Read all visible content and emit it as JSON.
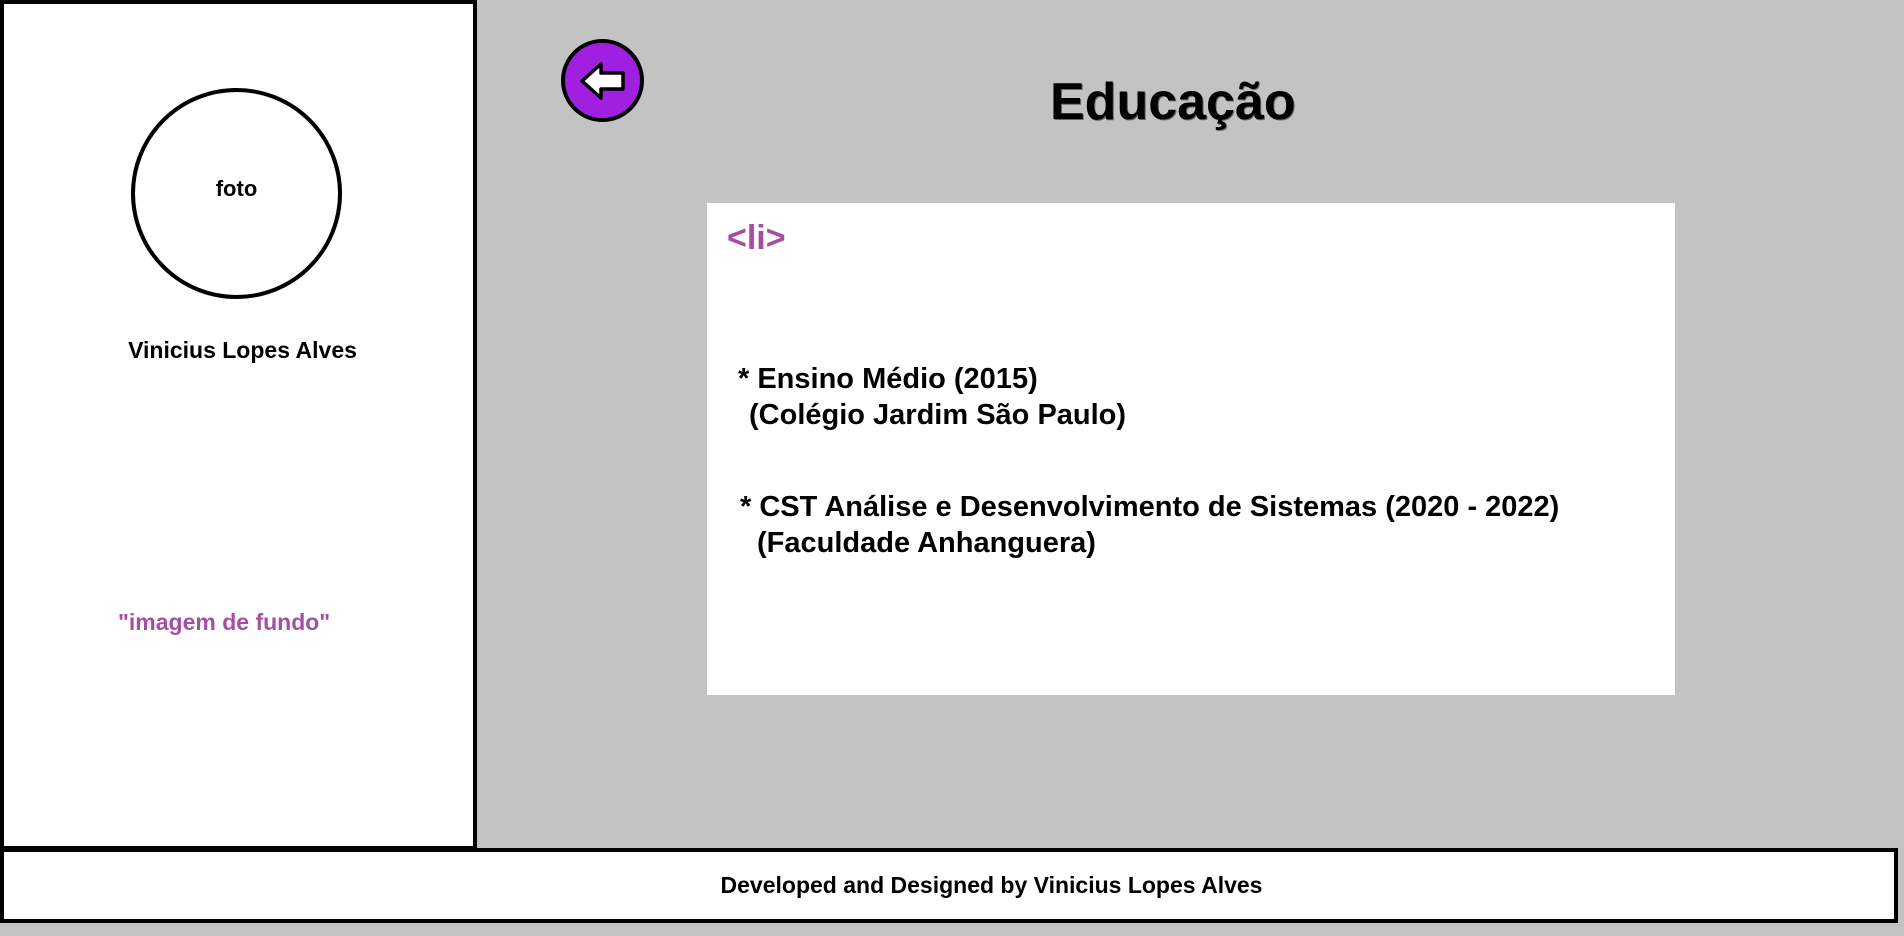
{
  "sidebar": {
    "photo_label": "foto",
    "name": "Vinicius Lopes Alves",
    "background_note": "\"imagem de fundo\""
  },
  "header": {
    "back_icon": "arrow-left-icon",
    "title": "Educação"
  },
  "card": {
    "tag": "<li>",
    "items": [
      {
        "line1": "* Ensino Médio (2015)",
        "line2": "(Colégio Jardim São Paulo)"
      },
      {
        "line1": "* CST Análise e Desenvolvimento de Sistemas (2020 - 2022)",
        "line2": "(Faculdade Anhanguera)"
      }
    ]
  },
  "footer": {
    "text": "Developed and Designed by Vinicius Lopes Alves"
  },
  "colors": {
    "background": "#c3c3c3",
    "accent_purple": "#a020e0",
    "annotation_purple": "#a64ea6"
  }
}
